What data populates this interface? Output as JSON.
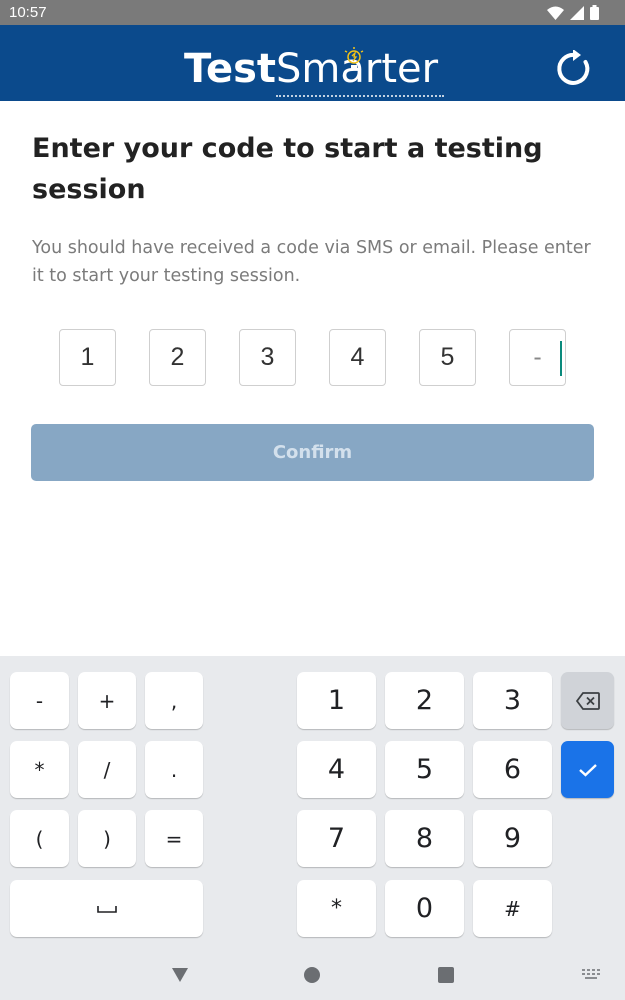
{
  "status_bar": {
    "time": "10:57",
    "icons": [
      "wifi-icon",
      "cell-signal-icon",
      "battery-icon"
    ]
  },
  "header": {
    "logo_test": "Test",
    "logo_smarter": "Smarter",
    "background_color": "#0b4a8c",
    "refresh_icon": "refresh-icon"
  },
  "main": {
    "title": "Enter your code to start a testing session",
    "subtitle": "You should have received a code via SMS or email. Please enter it to start your testing session.",
    "code_digits": [
      "1",
      "2",
      "3",
      "4",
      "5",
      "-"
    ],
    "confirm_label": "Confirm",
    "confirm_color": "#87a7c4"
  },
  "keyboard": {
    "symbol_keys": [
      "-",
      "+",
      ",",
      "*",
      "/",
      ".",
      "(",
      ")",
      "="
    ],
    "space_key_icon": "space-bar-icon",
    "number_keys": [
      "1",
      "2",
      "3",
      "4",
      "5",
      "6",
      "7",
      "8",
      "9",
      "*",
      "0",
      "#"
    ],
    "delete_icon": "backspace-icon",
    "enter_icon": "check-icon",
    "enter_color": "#1a73e8"
  },
  "nav_bar": {
    "buttons": [
      "back-triangle-icon",
      "home-circle-icon",
      "recents-square-icon",
      "keyboard-switch-icon"
    ]
  }
}
